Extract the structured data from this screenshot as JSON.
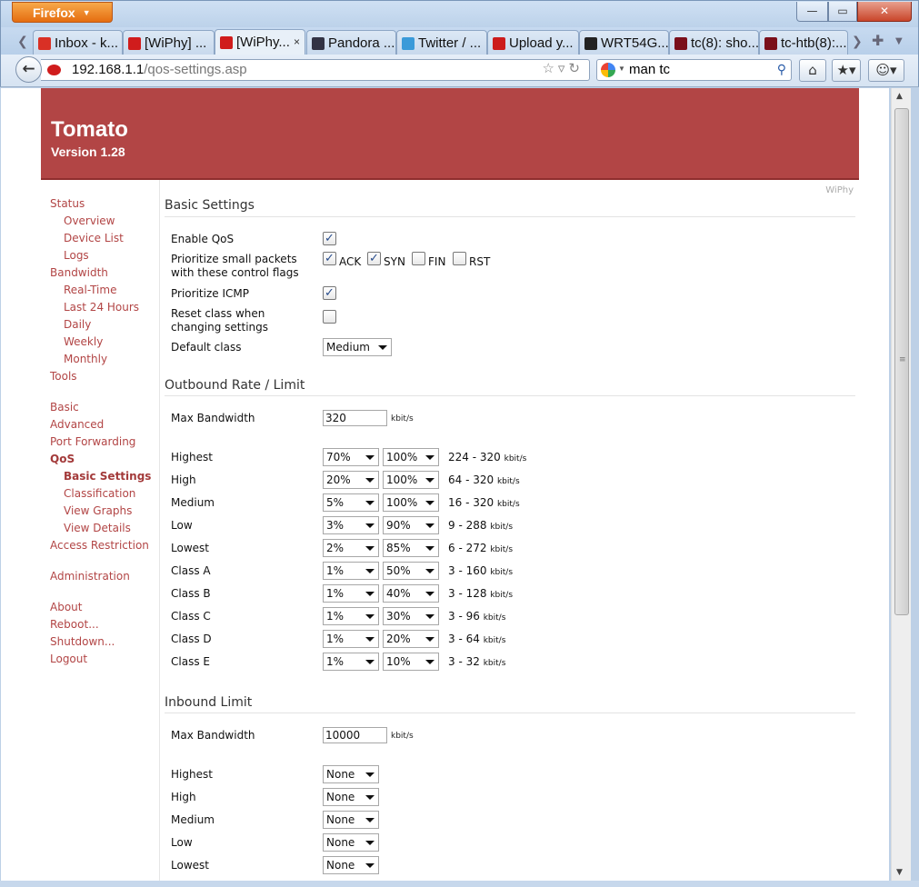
{
  "browser": {
    "menu_button": "Firefox",
    "window_controls": {
      "minimize": "—",
      "maximize": "▭",
      "close": "✕"
    },
    "tabs": [
      {
        "label": "Inbox - k...",
        "icon": "gmail-icon",
        "color": "#d93025"
      },
      {
        "label": "[WiPhy] ...",
        "icon": "tomato-icon",
        "color": "#d01c1c"
      },
      {
        "label": "[WiPhy...",
        "icon": "tomato-icon",
        "color": "#d01c1c"
      },
      {
        "label": "Pandora ...",
        "icon": "pandora-icon",
        "color": "#334"
      },
      {
        "label": "Twitter / ...",
        "icon": "twitter-icon",
        "color": "#3a9ad9"
      },
      {
        "label": "Upload y...",
        "icon": "youtube-icon",
        "color": "#cc1b1b"
      },
      {
        "label": "WRT54G...",
        "icon": "github-icon",
        "color": "#222"
      },
      {
        "label": "tc(8): sho...",
        "icon": "man-icon",
        "color": "#7a0f1a"
      },
      {
        "label": "tc-htb(8):...",
        "icon": "man-icon",
        "color": "#7a0f1a"
      }
    ],
    "url_host": "192.168.1.1",
    "url_path": "/qos-settings.asp",
    "search_value": "man tc"
  },
  "header": {
    "title": "Tomato",
    "version": "Version 1.28"
  },
  "sidebar": [
    {
      "label": "Status",
      "level": "top"
    },
    {
      "label": "Overview",
      "level": "sub"
    },
    {
      "label": "Device List",
      "level": "sub"
    },
    {
      "label": "Logs",
      "level": "sub"
    },
    {
      "label": "Bandwidth",
      "level": "top"
    },
    {
      "label": "Real-Time",
      "level": "sub"
    },
    {
      "label": "Last 24 Hours",
      "level": "sub"
    },
    {
      "label": "Daily",
      "level": "sub"
    },
    {
      "label": "Weekly",
      "level": "sub"
    },
    {
      "label": "Monthly",
      "level": "sub"
    },
    {
      "label": "Tools",
      "level": "top"
    },
    {
      "label": "Basic",
      "level": "top"
    },
    {
      "label": "Advanced",
      "level": "top"
    },
    {
      "label": "Port Forwarding",
      "level": "top"
    },
    {
      "label": "QoS",
      "level": "top",
      "active": true
    },
    {
      "label": "Basic Settings",
      "level": "sub",
      "active": true
    },
    {
      "label": "Classification",
      "level": "sub"
    },
    {
      "label": "View Graphs",
      "level": "sub"
    },
    {
      "label": "View Details",
      "level": "sub"
    },
    {
      "label": "Access Restriction",
      "level": "top"
    },
    {
      "label": "Administration",
      "level": "top"
    },
    {
      "label": "About",
      "level": "top"
    },
    {
      "label": "Reboot...",
      "level": "top"
    },
    {
      "label": "Shutdown...",
      "level": "top"
    },
    {
      "label": "Logout",
      "level": "top"
    }
  ],
  "router_name": "WiPhy",
  "basic": {
    "section_title": "Basic Settings",
    "enable_qos_label": "Enable QoS",
    "enable_qos": true,
    "prioritize_small_label_1": "Prioritize small packets",
    "prioritize_small_label_2": "with these control flags",
    "flags": [
      {
        "label": "ACK",
        "checked": true
      },
      {
        "label": "SYN",
        "checked": true
      },
      {
        "label": "FIN",
        "checked": false
      },
      {
        "label": "RST",
        "checked": false
      }
    ],
    "prioritize_icmp_label": "Prioritize ICMP",
    "prioritize_icmp": true,
    "reset_class_label_1": "Reset class when",
    "reset_class_label_2": "changing settings",
    "reset_class": false,
    "default_class_label": "Default class",
    "default_class": "Medium"
  },
  "outbound": {
    "section_title": "Outbound Rate / Limit",
    "max_bandwidth_label": "Max Bandwidth",
    "max_bandwidth": "320",
    "unit": "kbit/s",
    "classes": [
      {
        "name": "Highest",
        "rate": "70%",
        "limit": "100%",
        "range": "224 - 320"
      },
      {
        "name": "High",
        "rate": "20%",
        "limit": "100%",
        "range": "64 - 320"
      },
      {
        "name": "Medium",
        "rate": "5%",
        "limit": "100%",
        "range": "16 - 320"
      },
      {
        "name": "Low",
        "rate": "3%",
        "limit": "90%",
        "range": "9 - 288"
      },
      {
        "name": "Lowest",
        "rate": "2%",
        "limit": "85%",
        "range": "6 - 272"
      },
      {
        "name": "Class A",
        "rate": "1%",
        "limit": "50%",
        "range": "3 - 160"
      },
      {
        "name": "Class B",
        "rate": "1%",
        "limit": "40%",
        "range": "3 - 128"
      },
      {
        "name": "Class C",
        "rate": "1%",
        "limit": "30%",
        "range": "3 - 96"
      },
      {
        "name": "Class D",
        "rate": "1%",
        "limit": "20%",
        "range": "3 - 64"
      },
      {
        "name": "Class E",
        "rate": "1%",
        "limit": "10%",
        "range": "3 - 32"
      }
    ]
  },
  "inbound": {
    "section_title": "Inbound Limit",
    "max_bandwidth_label": "Max Bandwidth",
    "max_bandwidth": "10000",
    "unit": "kbit/s",
    "classes": [
      {
        "name": "Highest",
        "limit": "None"
      },
      {
        "name": "High",
        "limit": "None"
      },
      {
        "name": "Medium",
        "limit": "None"
      },
      {
        "name": "Low",
        "limit": "None"
      },
      {
        "name": "Lowest",
        "limit": "None"
      }
    ]
  }
}
